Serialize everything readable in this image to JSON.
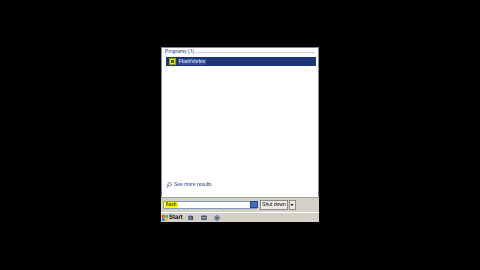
{
  "start_menu": {
    "section_header": "Programs (1)",
    "results": [
      {
        "label": "FlashVortex",
        "icon": "app-icon"
      }
    ],
    "see_more_label": "See more results",
    "search_value": "flash",
    "shutdown_label": "Shut down",
    "shutdown_arrow": "▸"
  },
  "taskbar": {
    "start_label": "Start",
    "quick_launch_icons": [
      "quick-launch-icon-1",
      "quick-launch-icon-2",
      "quick-launch-icon-3"
    ]
  },
  "colors": {
    "highlight": "#1e3678",
    "search_highlight": "#ffff00",
    "background": "#000000"
  }
}
